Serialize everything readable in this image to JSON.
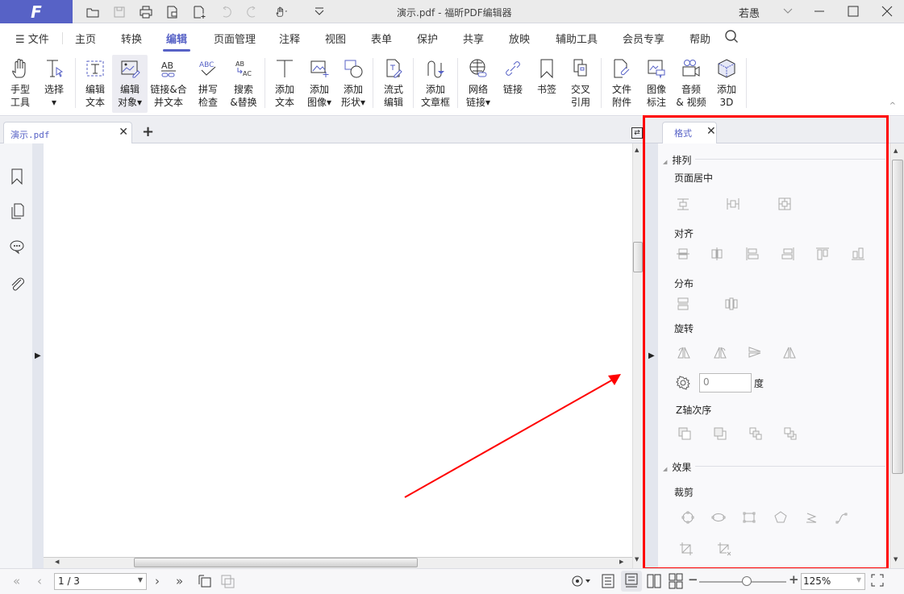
{
  "app": {
    "logo_letter": "F",
    "window_title": "演示.pdf - 福昕PDF编辑器",
    "user_name": "若愚",
    "accent_color": "#5762c6",
    "highlight_color": "#ff0000"
  },
  "quick_access": [
    "open-icon",
    "save-icon",
    "print-icon",
    "new-from-file-icon",
    "new-doc-icon",
    "undo-icon",
    "redo-icon",
    "hand-mode-icon",
    "customize-icon"
  ],
  "menu": {
    "file": "文件",
    "items": [
      "主页",
      "转换",
      "编辑",
      "页面管理",
      "注释",
      "视图",
      "表单",
      "保护",
      "共享",
      "放映",
      "辅助工具",
      "会员专享",
      "帮助"
    ],
    "active": "编辑"
  },
  "ribbon": {
    "buttons": [
      {
        "l1": "手型",
        "l2": "工具"
      },
      {
        "l1": "选择",
        "l2": "▾"
      },
      {
        "l1": "编辑",
        "l2": "文本"
      },
      {
        "l1": "编辑",
        "l2": "对象▾"
      },
      {
        "l1": "链接&合",
        "l2": "并文本"
      },
      {
        "l1": "拼写",
        "l2": "检查"
      },
      {
        "l1": "搜索",
        "l2": "&替换"
      },
      {
        "l1": "添加",
        "l2": "文本"
      },
      {
        "l1": "添加",
        "l2": "图像▾"
      },
      {
        "l1": "添加",
        "l2": "形状▾"
      },
      {
        "l1": "流式",
        "l2": "编辑"
      },
      {
        "l1": "添加",
        "l2": "文章框"
      },
      {
        "l1": "网络",
        "l2": "链接▾"
      },
      {
        "l1": "链接",
        "l2": ""
      },
      {
        "l1": "书签",
        "l2": ""
      },
      {
        "l1": "交叉",
        "l2": "引用"
      },
      {
        "l1": "文件",
        "l2": "附件"
      },
      {
        "l1": "图像",
        "l2": "标注"
      },
      {
        "l1": "音频",
        "l2": "& 视频"
      },
      {
        "l1": "添加",
        "l2": "3D"
      }
    ]
  },
  "document": {
    "tab_name": "演示.pdf",
    "add_tab": "+"
  },
  "format_panel": {
    "tab_label": "格式",
    "sections": {
      "arrange": "排列",
      "page_center": "页面居中",
      "align": "对齐",
      "distribute": "分布",
      "rotate": "旋转",
      "rotation_value": "0",
      "rotation_unit": "度",
      "z_order": "Z轴次序",
      "effects": "效果",
      "crop": "裁剪"
    }
  },
  "statusbar": {
    "page_value": "1 / 3",
    "zoom_value": "125%",
    "zoom_level_percent": 125
  }
}
